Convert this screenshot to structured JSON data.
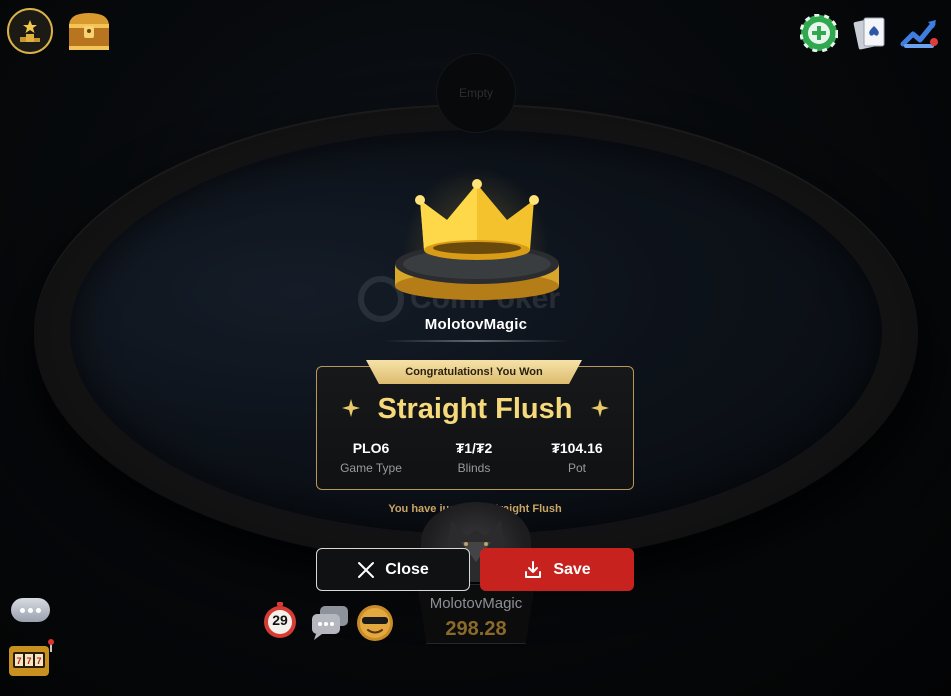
{
  "table": {
    "empty_seat_label": "Empty",
    "watermark_text": "CoinPoker"
  },
  "result": {
    "winner_name": "MolotovMagic",
    "banner": "Congratulations! You Won",
    "hand": "Straight Flush",
    "stats": [
      {
        "value": "PLO6",
        "label": "Game Type"
      },
      {
        "value": "₮1/₮2",
        "label": "Blinds"
      },
      {
        "value": "₮104.16",
        "label": "Pot"
      }
    ],
    "message": "You have just hit a Straight Flush"
  },
  "buttons": {
    "close_label": "Close",
    "save_label": "Save"
  },
  "player": {
    "name": "MolotovMagic",
    "stack": "298.28"
  },
  "timer": {
    "value": "29"
  },
  "colors": {
    "gold": "#f6d97a",
    "save_red": "#c7221e",
    "add_green": "#2fa84f"
  },
  "icons": {
    "top_left": [
      "leaderboard-trophy-icon",
      "treasure-chest-icon"
    ],
    "top_right": [
      "add-chips-icon",
      "cards-icon",
      "stats-chart-icon"
    ],
    "bottom": [
      "chat-bubble-icon",
      "slot-machine-icon",
      "timer-icon",
      "chat-icon",
      "emoji-icon"
    ]
  }
}
